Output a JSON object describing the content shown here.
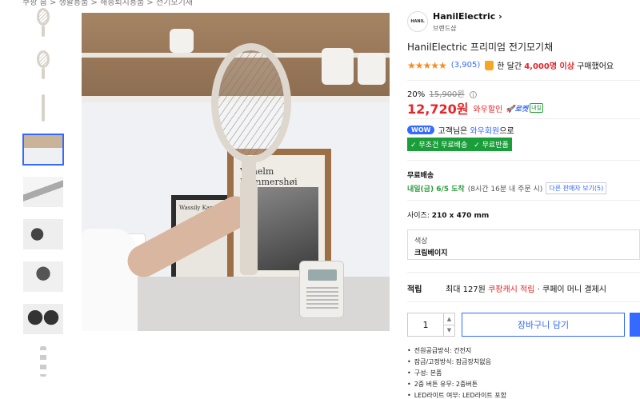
{
  "breadcrumb": "쿠팡 홈 > 생활용품 > 해충퇴치용품 > 전기모기채",
  "brand": {
    "logo_text": "HANIL",
    "name": "HanilElectric",
    "sub": "브랜드샵"
  },
  "product": {
    "title": "HanilElectric 프리미엄 전기모기채",
    "stars": "★★★★★",
    "review_count": "(3,905)",
    "purchase_prefix": "한 달간",
    "purchase_count": "4,000명 이상",
    "purchase_suffix": "구매했어요",
    "discount_rate": "20%",
    "original_price": "15,900원",
    "sale_price": "12,720원",
    "wow_sale": "와우할인",
    "rocket": "로켓",
    "rocket_sub": "내일",
    "wow_badge": "WOW",
    "wow_text_prefix": "고객님은",
    "wow_text_member": "와우회원",
    "wow_text_suffix": "으로",
    "benefit_free_shipping": "✓ 무조건 무료배송",
    "benefit_free_return": "✓ 무료반품",
    "shipping_label": "무료배송",
    "shipping_date": "내일(금) 6/5 도착",
    "shipping_note": "(8시간 16분 내 주문 시)",
    "other_sellers": "다른 판매자 보기(5)",
    "size_label": "사이즈:",
    "size_value": "210 x 470 mm",
    "option_label": "색상",
    "option_value": "크림베이지",
    "reward_label": "적립",
    "reward_prefix": "최대 127원",
    "reward_highlight": "쿠팡캐시 적립",
    "reward_suffix": "· 쿠페이 머니 결제시",
    "quantity": "1",
    "cart_button": "장바구니 담기",
    "specs": [
      "전원공급방식: 건전지",
      "잠금/고정방식: 잠금장치없음",
      "구성: 본품",
      "2중 버튼 유무: 2중버튼",
      "LED라이트 여부: LED라이트 포함"
    ]
  },
  "image_text": {
    "frame_title": "Vilhelm Hammershøi",
    "frame2_title": "Wassily Kandinsky"
  }
}
